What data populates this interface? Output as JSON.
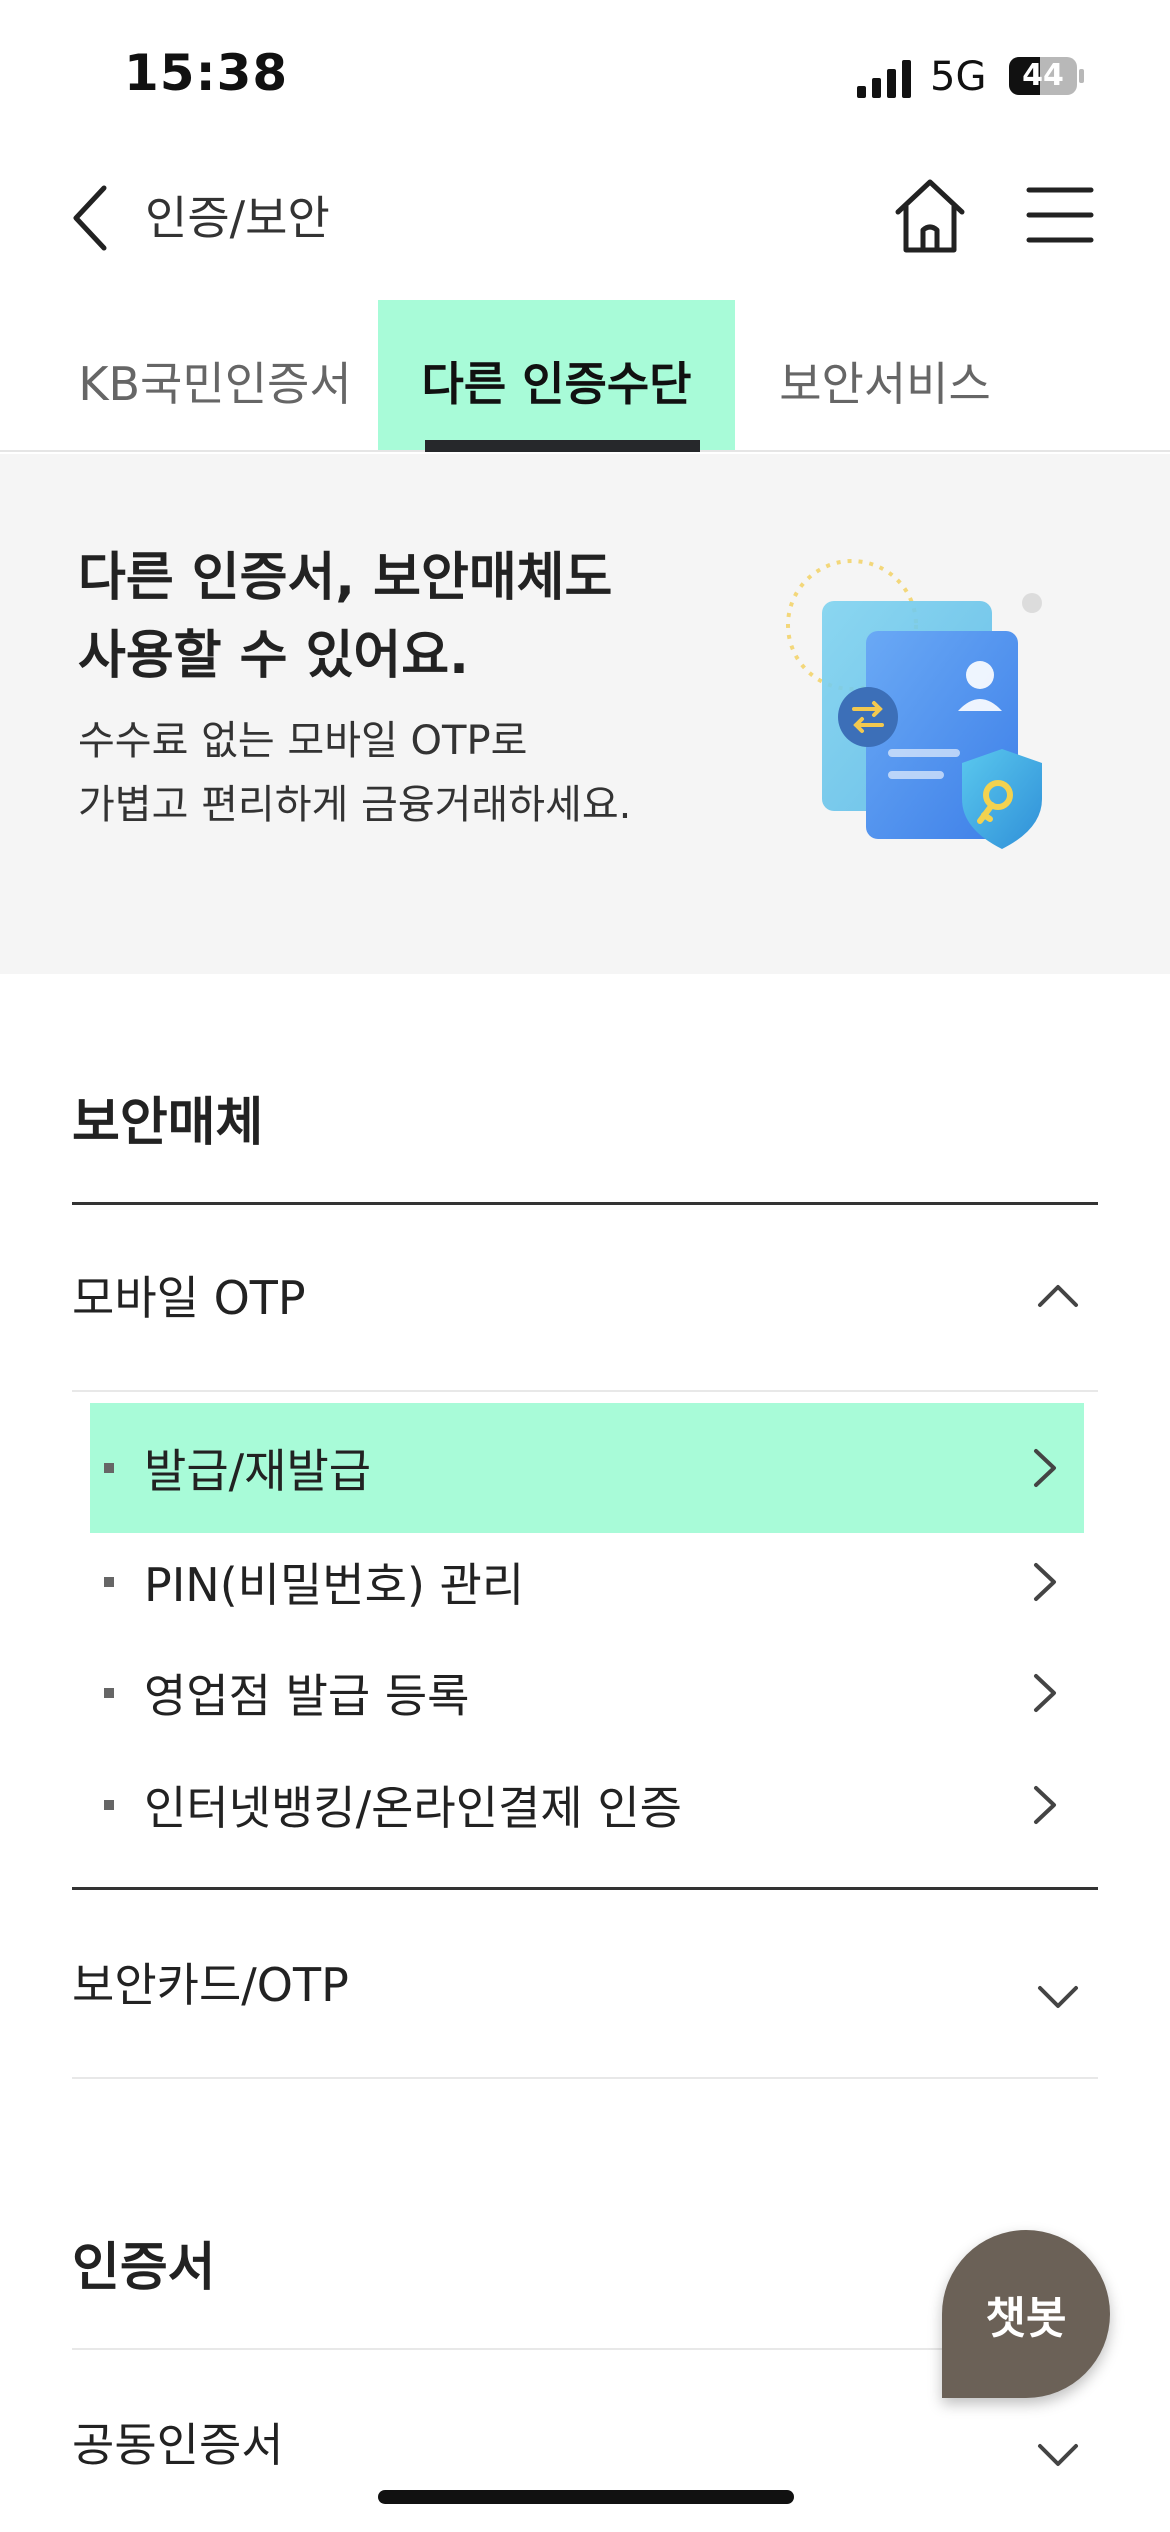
{
  "status_bar": {
    "time": "15:38",
    "network": "5G",
    "battery": "44"
  },
  "header": {
    "title": "인증/보안",
    "back_icon": "chevron-left-icon",
    "home_icon": "home-icon",
    "menu_icon": "hamburger-menu-icon"
  },
  "tabs": [
    {
      "label": "KB국민인증서",
      "active": false
    },
    {
      "label": "다른 인증수단",
      "active": true
    },
    {
      "label": "보안서비스",
      "active": false
    }
  ],
  "banner": {
    "title_line1": "다른 인증서, 보안매체도",
    "title_line2": "사용할 수 있어요.",
    "desc_line1": "수수료 없는 모바일 OTP로",
    "desc_line2": "가볍고 편리하게 금융거래하세요."
  },
  "sections": {
    "security_media": {
      "title": "보안매체",
      "accordions": [
        {
          "title": "모바일 OTP",
          "expanded": true,
          "items": [
            {
              "label": "발급/재발급",
              "active": true
            },
            {
              "label": "PIN(비밀번호) 관리",
              "active": false
            },
            {
              "label": "영업점 발급 등록",
              "active": false
            },
            {
              "label": "인터넷뱅킹/온라인결제 인증",
              "active": false
            }
          ]
        },
        {
          "title": "보안카드/OTP",
          "expanded": false
        }
      ]
    },
    "certificates": {
      "title": "인증서",
      "accordions": [
        {
          "title": "공동인증서",
          "expanded": false
        }
      ]
    }
  },
  "chatbot": {
    "label": "챗봇"
  },
  "colors": {
    "highlight": "#a8fbd8",
    "tab_underline": "#26282b",
    "banner_bg": "#f5f5f5",
    "chatbot_bg": "#6b6157"
  }
}
